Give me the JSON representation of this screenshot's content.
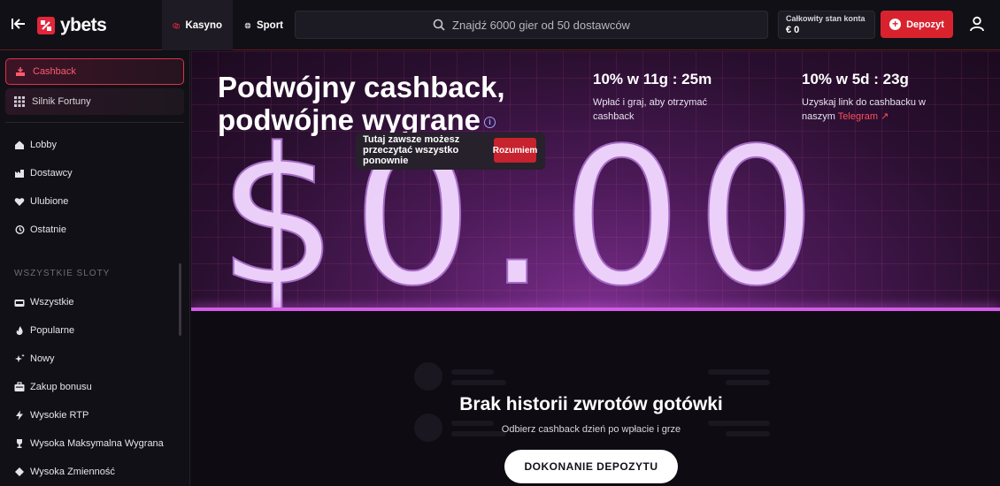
{
  "header": {
    "logo_text": "ybets",
    "tabs": [
      {
        "label": "Kasyno",
        "active": true
      },
      {
        "label": "Sport",
        "active": false
      }
    ],
    "search_placeholder": "Znajdź 6000 gier od 50 dostawców",
    "balance_label": "Całkowity stan konta",
    "balance_value": "€ 0",
    "deposit_label": "Depozyt",
    "accent_color": "#d8232f"
  },
  "sidebar": {
    "promos": [
      {
        "label": "Cashback",
        "icon": "cashback-icon",
        "active": true
      },
      {
        "label": "Silnik Fortuny",
        "icon": "grid-icon",
        "active": false
      }
    ],
    "main_items": [
      {
        "label": "Lobby",
        "icon": "home-icon"
      },
      {
        "label": "Dostawcy",
        "icon": "providers-icon"
      },
      {
        "label": "Ulubione",
        "icon": "heart-icon"
      },
      {
        "label": "Ostatnie",
        "icon": "history-icon"
      }
    ],
    "section_heading": "WSZYSTKIE SLOTY",
    "slot_items": [
      {
        "label": "Wszystkie",
        "icon": "slot-machine-icon"
      },
      {
        "label": "Popularne",
        "icon": "fire-icon"
      },
      {
        "label": "Nowy",
        "icon": "sparkle-icon"
      },
      {
        "label": "Zakup bonusu",
        "icon": "bonus-icon"
      },
      {
        "label": "Wysokie RTP",
        "icon": "lightning-icon"
      },
      {
        "label": "Wysoka Maksymalna Wygrana",
        "icon": "trophy-icon"
      },
      {
        "label": "Wysoka Zmienność",
        "icon": "volatility-icon"
      }
    ]
  },
  "hero": {
    "title_line1": "Podwójny cashback,",
    "title_line2": "podwójne wygrane",
    "amount": "$0.00",
    "tooltip_text": "Tutaj zawsze możesz przeczytać wszystko ponownie",
    "tooltip_button": "Rozumiem",
    "stat1_title": "10% w 11g : 25m",
    "stat1_desc": "Wpłać i graj, aby otrzymać cashback",
    "stat2_title": "10% w 5d : 23g",
    "stat2_desc": "Uzyskaj link do cashbacku w naszym",
    "stat2_link": "Telegram"
  },
  "empty_state": {
    "title": "Brak historii zwrotów gotówki",
    "subtitle": "Odbierz cashback dzień po wpłacie i grze",
    "cta_label": "DOKONANIE DEPOZYTU"
  }
}
